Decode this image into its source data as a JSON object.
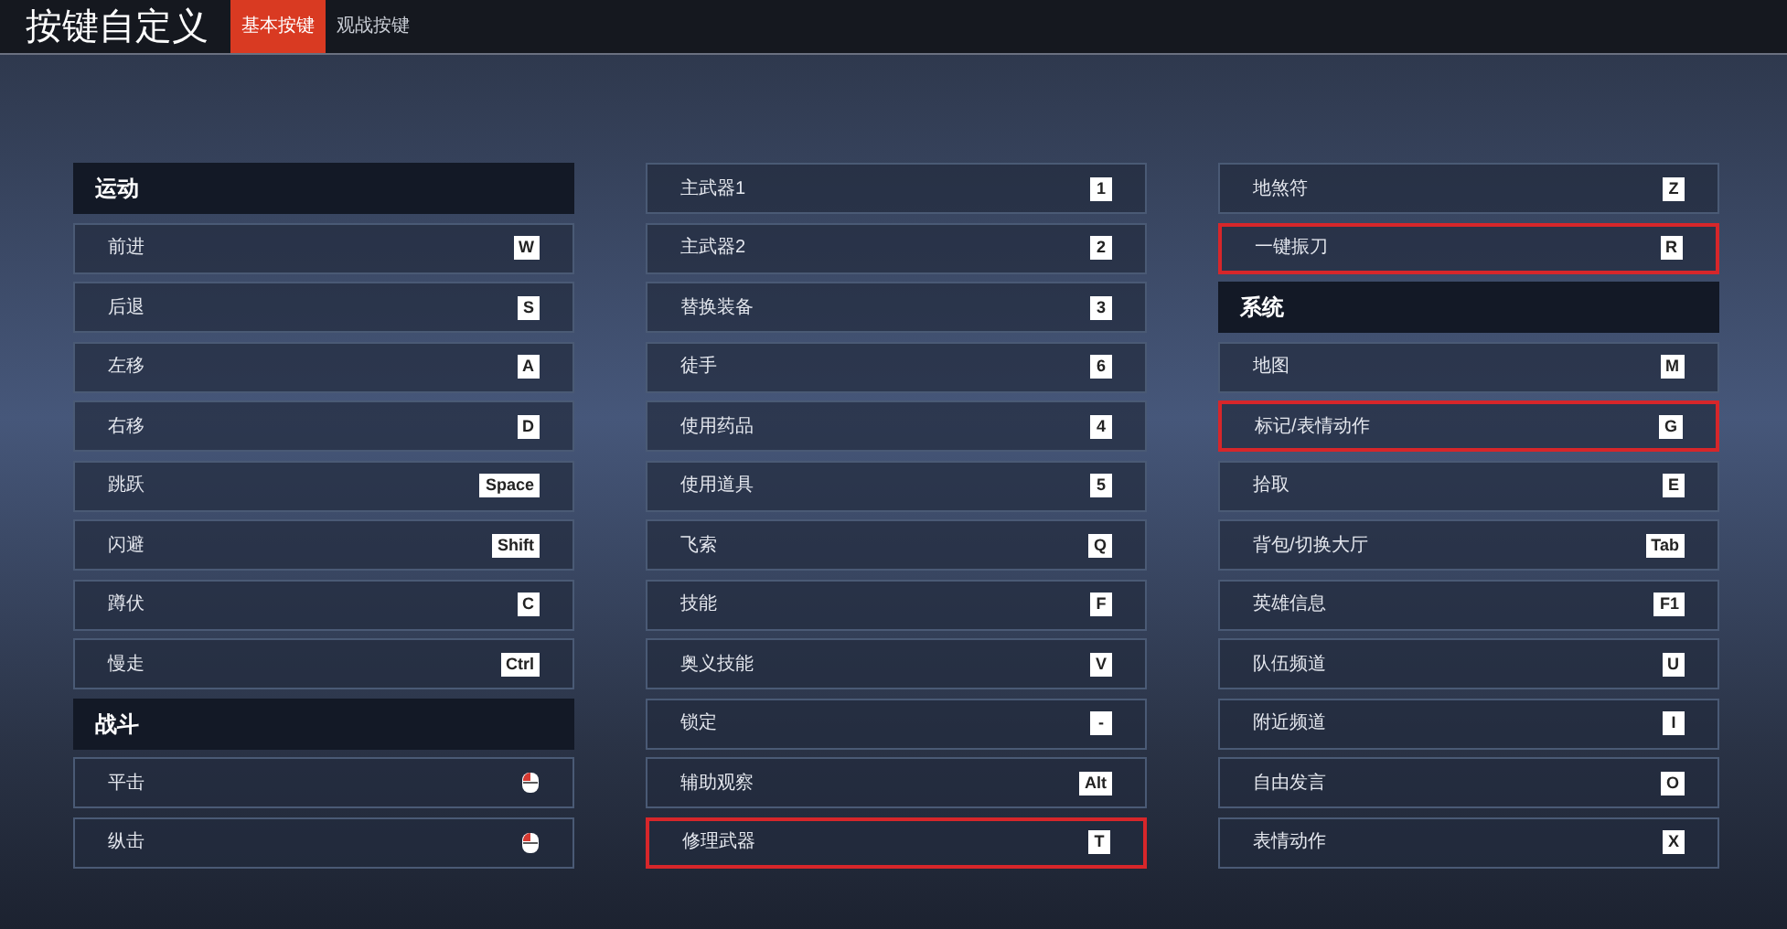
{
  "title": "按键自定义",
  "tabs": [
    {
      "label": "基本按键",
      "selected": true
    },
    {
      "label": "观战按键",
      "selected": false
    }
  ],
  "columns": [
    {
      "items": [
        {
          "kind": "header",
          "label": "运动"
        },
        {
          "kind": "key",
          "label": "前进",
          "key": "W",
          "highlighted": false
        },
        {
          "kind": "key",
          "label": "后退",
          "key": "S",
          "highlighted": false
        },
        {
          "kind": "key",
          "label": "左移",
          "key": "A",
          "highlighted": false
        },
        {
          "kind": "key",
          "label": "右移",
          "key": "D",
          "highlighted": false
        },
        {
          "kind": "key",
          "label": "跳跃",
          "key": "Space",
          "highlighted": false
        },
        {
          "kind": "key",
          "label": "闪避",
          "key": "Shift",
          "highlighted": false
        },
        {
          "kind": "key",
          "label": "蹲伏",
          "key": "C",
          "highlighted": false
        },
        {
          "kind": "key",
          "label": "慢走",
          "key": "Ctrl",
          "highlighted": false
        },
        {
          "kind": "header",
          "label": "战斗"
        },
        {
          "kind": "mouse",
          "label": "平击",
          "highlighted": false
        },
        {
          "kind": "mouse",
          "label": "纵击",
          "highlighted": false
        }
      ]
    },
    {
      "items": [
        {
          "kind": "key",
          "label": "主武器1",
          "key": "1",
          "highlighted": false
        },
        {
          "kind": "key",
          "label": "主武器2",
          "key": "2",
          "highlighted": false
        },
        {
          "kind": "key",
          "label": "替换装备",
          "key": "3",
          "highlighted": false
        },
        {
          "kind": "key",
          "label": "徒手",
          "key": "6",
          "highlighted": false
        },
        {
          "kind": "key",
          "label": "使用药品",
          "key": "4",
          "highlighted": false
        },
        {
          "kind": "key",
          "label": "使用道具",
          "key": "5",
          "highlighted": false
        },
        {
          "kind": "key",
          "label": "飞索",
          "key": "Q",
          "highlighted": false
        },
        {
          "kind": "key",
          "label": "技能",
          "key": "F",
          "highlighted": false
        },
        {
          "kind": "key",
          "label": "奥义技能",
          "key": "V",
          "highlighted": false
        },
        {
          "kind": "key",
          "label": "锁定",
          "key": "-",
          "highlighted": false
        },
        {
          "kind": "key",
          "label": "辅助观察",
          "key": "Alt",
          "highlighted": false
        },
        {
          "kind": "key",
          "label": "修理武器",
          "key": "T",
          "highlighted": true
        }
      ]
    },
    {
      "items": [
        {
          "kind": "key",
          "label": "地煞符",
          "key": "Z",
          "highlighted": false
        },
        {
          "kind": "key",
          "label": "一键振刀",
          "key": "R",
          "highlighted": true
        },
        {
          "kind": "header",
          "label": "系统"
        },
        {
          "kind": "key",
          "label": "地图",
          "key": "M",
          "highlighted": false
        },
        {
          "kind": "key",
          "label": "标记/表情动作",
          "key": "G",
          "highlighted": true
        },
        {
          "kind": "key",
          "label": "拾取",
          "key": "E",
          "highlighted": false
        },
        {
          "kind": "key",
          "label": "背包/切换大厅",
          "key": "Tab",
          "highlighted": false
        },
        {
          "kind": "key",
          "label": "英雄信息",
          "key": "F1",
          "highlighted": false
        },
        {
          "kind": "key",
          "label": "队伍频道",
          "key": "U",
          "highlighted": false
        },
        {
          "kind": "key",
          "label": "附近频道",
          "key": "I",
          "highlighted": false
        },
        {
          "kind": "key",
          "label": "自由发言",
          "key": "O",
          "highlighted": false
        },
        {
          "kind": "key",
          "label": "表情动作",
          "key": "X",
          "highlighted": false
        }
      ]
    }
  ]
}
